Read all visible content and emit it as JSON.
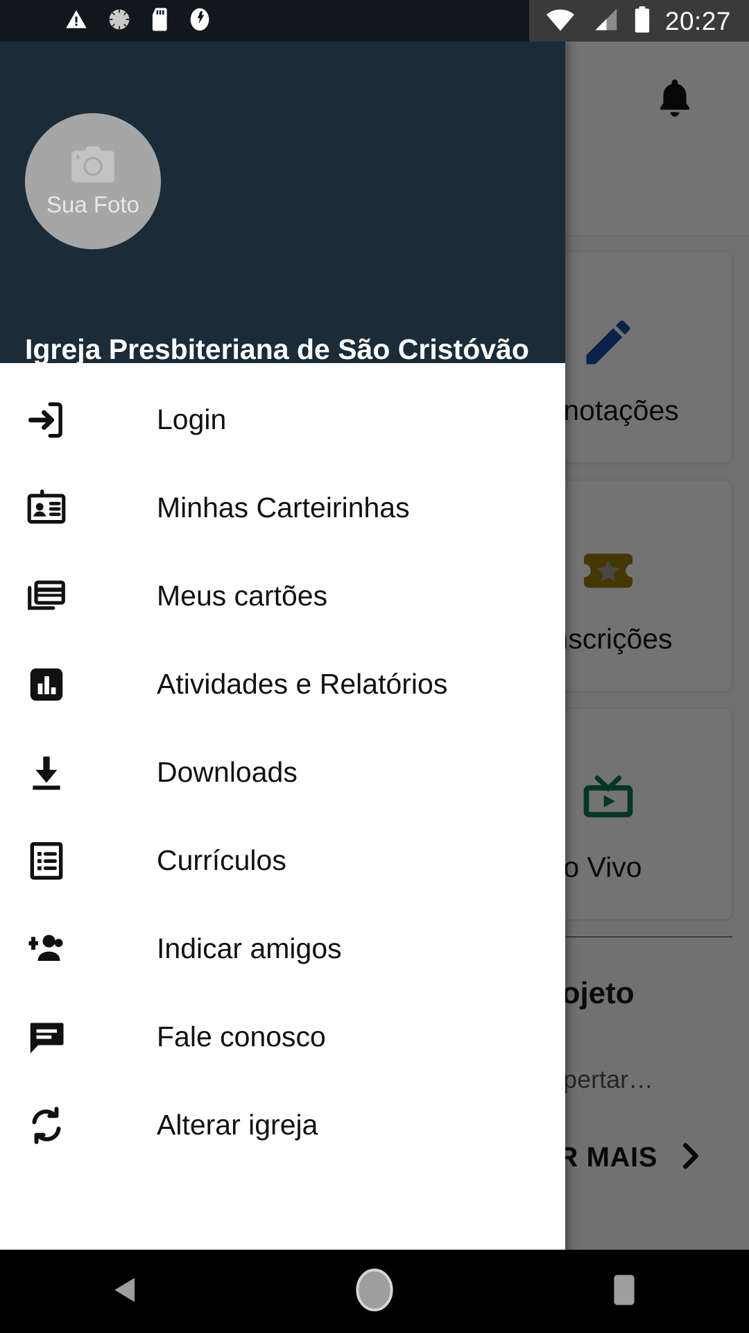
{
  "status_bar": {
    "time": "20:27",
    "left_icons": [
      "warning-triangle-icon",
      "sync-progress-icon",
      "sd-card-icon",
      "usb-debug-icon"
    ],
    "right_icons": [
      "wifi-icon",
      "cellular-signal-icon",
      "battery-icon"
    ],
    "background": "#10171d",
    "right_background": "#3a3a3a"
  },
  "drawer": {
    "header": {
      "background": "#1b2c38",
      "avatar_placeholder_text": "Sua Foto",
      "avatar_icon": "camera-icon",
      "avatar_background": "#a6a6a6",
      "church_name": "Igreja Presbiteriana de São Cristóvão"
    },
    "menu_items": [
      {
        "label": "Login",
        "icon": "login-icon"
      },
      {
        "label": "Minhas Carteirinhas",
        "icon": "id-badge-icon"
      },
      {
        "label": "Meus cartões",
        "icon": "cards-stack-icon"
      },
      {
        "label": "Atividades e Relatórios",
        "icon": "bar-chart-icon"
      },
      {
        "label": "Downloads",
        "icon": "download-icon"
      },
      {
        "label": "Currículos",
        "icon": "list-document-icon"
      },
      {
        "label": "Indicar amigos",
        "icon": "person-add-icon"
      },
      {
        "label": "Fale conosco",
        "icon": "chat-bubble-icon"
      },
      {
        "label": "Alterar igreja",
        "icon": "sync-icon"
      }
    ]
  },
  "background_app": {
    "appbar": {
      "notification_icon": "bell-icon"
    },
    "cards": [
      {
        "label": "Anotações",
        "icon": "pencil-icon",
        "color": "#1a4f9c"
      },
      {
        "label": "Inscrições",
        "icon": "ticket-star-icon",
        "color": "#9a7b06"
      },
      {
        "label": "Ao Vivo",
        "icon": "live-tv-icon",
        "color": "#0b7a4b"
      }
    ],
    "promo": {
      "title": "o Projeto",
      "subtitle": "etivo\nr, despertar…",
      "more_button": "VER MAIS",
      "more_icon": "chevron-right-icon"
    }
  },
  "nav_bar": {
    "buttons": [
      {
        "name": "back",
        "icon": "back-triangle-icon"
      },
      {
        "name": "home",
        "icon": "home-circle-icon"
      },
      {
        "name": "recents",
        "icon": "recents-square-icon"
      }
    ]
  }
}
